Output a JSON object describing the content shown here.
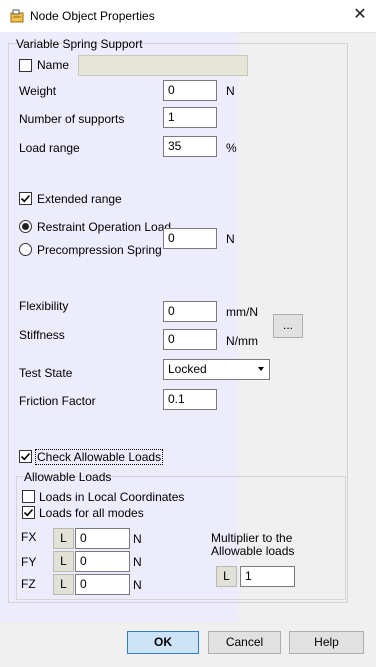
{
  "window": {
    "title": "Node Object Properties",
    "icon": "node-properties-icon"
  },
  "vss": {
    "group_title": "Variable Spring Support",
    "name_label": "Name",
    "name_value": "",
    "weight_label": "Weight",
    "weight_value": "0",
    "weight_unit": "N",
    "supports_label": "Number of supports",
    "supports_value": "1",
    "load_range_label": "Load range",
    "load_range_value": "35",
    "load_range_unit": "%",
    "extended_range_label": "Extended range",
    "extended_range_checked": true,
    "restraint_label": "Restraint Operation Load",
    "precompression_label": "Precompression Spring",
    "operation_value": "0",
    "operation_unit": "N",
    "flexibility_label": "Flexibility",
    "flexibility_value": "0",
    "flexibility_unit": "mm/N",
    "stiffness_label": "Stiffness",
    "stiffness_value": "0",
    "stiffness_unit": "N/mm",
    "browse_label": "...",
    "test_state_label": "Test State",
    "test_state_value": "Locked",
    "friction_label": "Friction Factor",
    "friction_value": "0.1",
    "check_allowable_label": "Check Allowable Loads",
    "check_allowable_checked": true
  },
  "allowable": {
    "group_title": "Allowable Loads",
    "local_coords_label": "Loads in Local Coordinates",
    "local_coords_checked": false,
    "all_modes_label": "Loads for all modes",
    "all_modes_checked": true,
    "rows": [
      {
        "axis": "FX",
        "btn": "L",
        "value": "0",
        "unit": "N"
      },
      {
        "axis": "FY",
        "btn": "L",
        "value": "0",
        "unit": "N"
      },
      {
        "axis": "FZ",
        "btn": "L",
        "value": "0",
        "unit": "N"
      }
    ],
    "multiplier_label_line1": "Multiplier to the",
    "multiplier_label_line2": "Allowable loads",
    "multiplier_btn": "L",
    "multiplier_value": "1"
  },
  "buttons": {
    "ok": "OK",
    "cancel": "Cancel",
    "help": "Help"
  },
  "icons": {
    "close": "close-icon",
    "dropdown": "chevron-down-icon",
    "check": "checkmark-icon"
  },
  "colors": {
    "panel_tint": "#ebebff",
    "default_button": "#cde3f7",
    "default_button_border": "#2f7ad2"
  }
}
